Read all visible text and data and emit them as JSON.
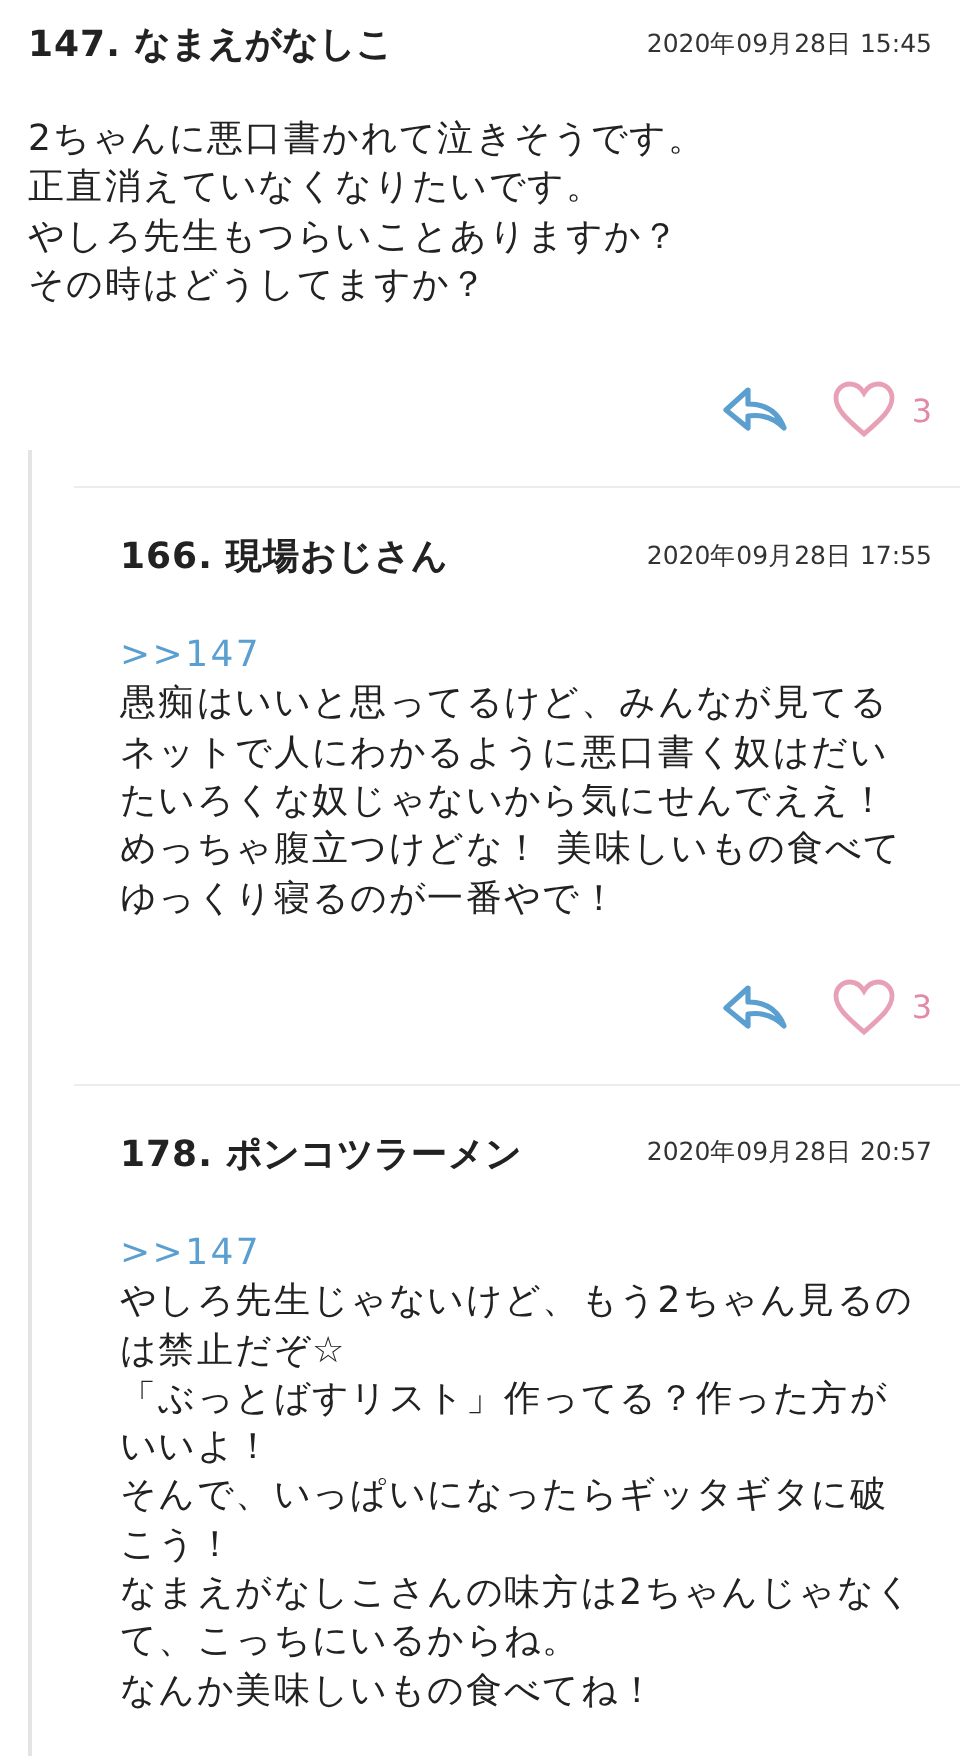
{
  "post": {
    "number": "147.",
    "author": "なまえがなしこ",
    "date": "2020年09月28日 15:45",
    "lines": [
      "2ちゃんに悪口書かれて泣きそうです。",
      "正直消えていなくなりたいです。",
      "やしろ先生もつらいことありますか？",
      "その時はどうしてますか？"
    ],
    "likes": "3"
  },
  "replies": [
    {
      "number": "166.",
      "author": "現場おじさん",
      "date": "2020年09月28日 17:55",
      "anchor": ">>147",
      "lines": [
        "愚痴はいいと思ってるけど、みんなが見てる",
        "ネットで人にわかるように悪口書く奴はだい",
        "たいろくな奴じゃないから気にせんでええ！",
        "めっちゃ腹立つけどな！ 美味しいもの食べて",
        "ゆっくり寝るのが一番やで！"
      ],
      "likes": "3"
    },
    {
      "number": "178.",
      "author": "ポンコツラーメン",
      "date": "2020年09月28日 20:57",
      "anchor": ">>147",
      "lines": [
        "やしろ先生じゃないけど、もう2ちゃん見るの",
        "は禁止だぞ☆",
        "「ぶっとばすリスト」作ってる？作った方が",
        "いいよ！",
        "そんで、いっぱいになったらギッタギタに破",
        "こう！",
        "なまえがなしこさんの味方は2ちゃんじゃなく",
        "て、こっちにいるからね。",
        "なんか美味しいもの食べてね！"
      ]
    }
  ]
}
